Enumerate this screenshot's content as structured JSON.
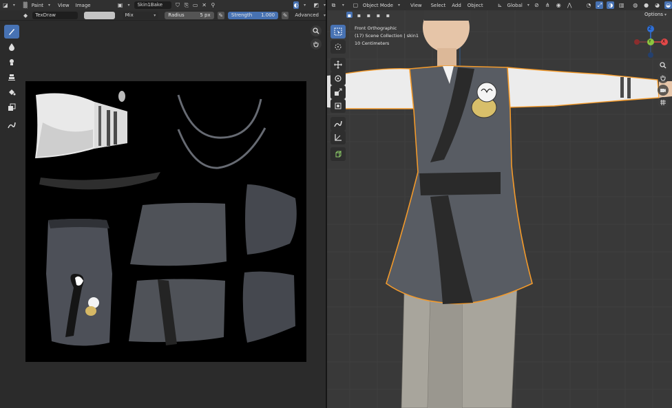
{
  "left_header": {
    "mode_label": "Paint",
    "menu_view": "View",
    "menu_image": "Image",
    "image_name": "Skin1Bake"
  },
  "tool_settings": {
    "brush_name": "TexDraw",
    "blend_mode": "Mix",
    "radius_label": "Radius",
    "radius_value": "5 px",
    "strength_label": "Strength",
    "strength_value": "1.000",
    "advanced_label": "Advanced"
  },
  "right_header": {
    "mode_label": "Object Mode",
    "menu_view": "View",
    "menu_select": "Select",
    "menu_add": "Add",
    "menu_object": "Object",
    "transform_orientation": "Global",
    "options_label": "Options"
  },
  "viewport_overlay": {
    "view_name": "Front Orthographic",
    "collection_info": "(17) Scene Collection | skin1",
    "grid_scale": "10 Centimeters"
  },
  "gizmo": {
    "z_label": "Z",
    "x_label": "X",
    "y_label": "Y"
  },
  "colors": {
    "accent": "#4772b3",
    "selection_outline": "#f39a2b",
    "tunic": "#585c63",
    "sash": "#2a2a2a",
    "sleeve": "#e8e8e8",
    "trousers": "#a8a59c",
    "skin": "#e6c5a8",
    "badge": "#d8bf6a"
  },
  "icons": {
    "left_toolbar": [
      "draw-brush-icon",
      "soften-icon",
      "smear-icon",
      "clone-icon",
      "fill-icon",
      "mask-icon",
      "annotate-icon"
    ],
    "right_toolbar": [
      "select-box-icon",
      "cursor-icon",
      "move-icon",
      "rotate-icon",
      "scale-icon",
      "transform-icon",
      "annotate-icon",
      "measure-icon",
      "add-cube-icon"
    ]
  }
}
